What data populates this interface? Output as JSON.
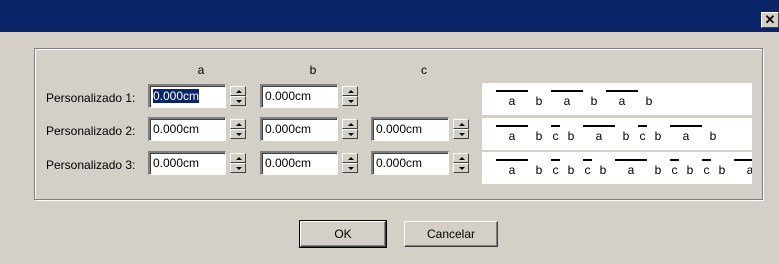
{
  "window": {
    "close_glyph": "✕",
    "close_icon": "close-icon"
  },
  "columns": [
    "a",
    "b",
    "c"
  ],
  "rows": [
    {
      "label": "Personalizado 1:",
      "a": "0.000cm",
      "b": "0.000cm",
      "preview": [
        "a",
        "b",
        "a",
        "b",
        "a",
        "b"
      ]
    },
    {
      "label": "Personalizado 2:",
      "a": "0.000cm",
      "b": "0.000cm",
      "c": "0.000cm",
      "preview": [
        "a",
        "b",
        "c",
        "b",
        "a",
        "b",
        "c",
        "b",
        "a",
        "b"
      ]
    },
    {
      "label": "Personalizado 3:",
      "a": "0.000cm",
      "b": "0.000cm",
      "c": "0.000cm",
      "preview": [
        "a",
        "b",
        "c",
        "b",
        "c",
        "b",
        "a",
        "b",
        "c",
        "b",
        "c",
        "b",
        "a"
      ]
    }
  ],
  "buttons": {
    "ok": "OK",
    "cancel": "Cancelar"
  },
  "colors": {
    "title_bar": "#0a246a",
    "dialog": "#d4d0c8",
    "selection": "#0a246a"
  }
}
